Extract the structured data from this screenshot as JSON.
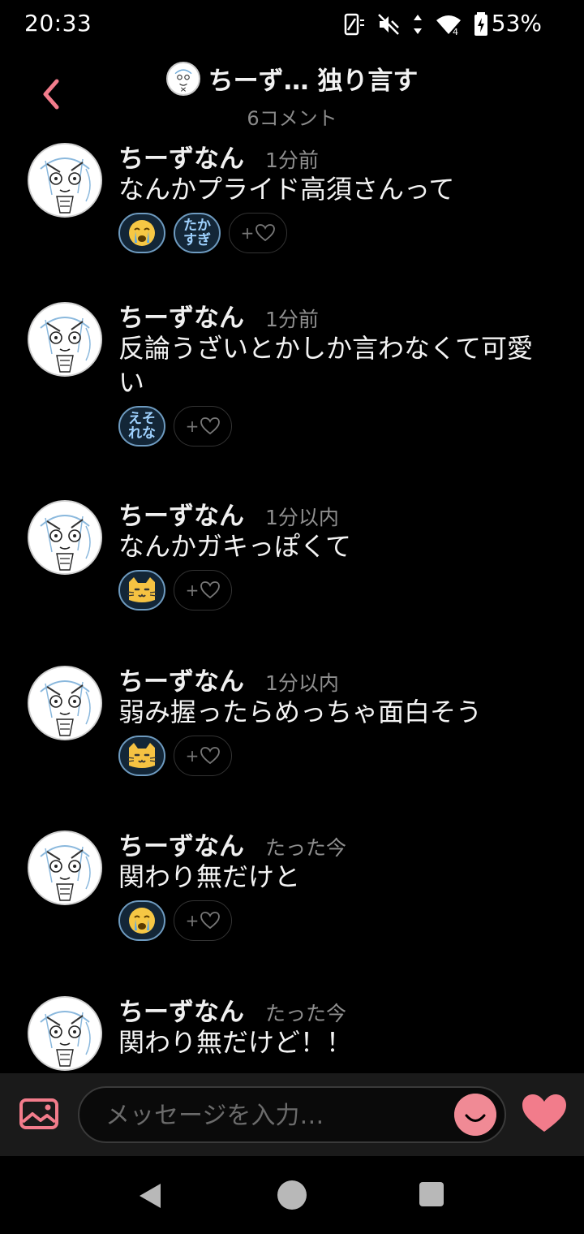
{
  "status_bar": {
    "time": "20:33",
    "battery": "53%",
    "icons": [
      "screen-rotate-icon",
      "vibrate-off-icon",
      "data-arrows-icon",
      "wifi-icon",
      "battery-charging-icon"
    ]
  },
  "header": {
    "back_icon": "chevron-left-icon",
    "title": "ちーず… 独り言す",
    "subtitle": "6コメント",
    "accent": "#f27c8b"
  },
  "comments": [
    {
      "name": "ちーずなん",
      "time": "1分前",
      "text": "なんかプライド高須さんって",
      "reactions": [
        {
          "type": "emoji",
          "icon": "crying-face-icon"
        },
        {
          "type": "stamp",
          "text": "たか\nすぎ"
        }
      ]
    },
    {
      "name": "ちーずなん",
      "time": "1分前",
      "text": "反論うざいとかしか言わなくて可愛い",
      "reactions": [
        {
          "type": "stamp",
          "text": "えそ\nれな"
        }
      ]
    },
    {
      "name": "ちーずなん",
      "time": "1分以内",
      "text": "なんかガキっぽくて",
      "reactions": [
        {
          "type": "emoji",
          "icon": "cat-face-icon"
        }
      ]
    },
    {
      "name": "ちーずなん",
      "time": "1分以内",
      "text": "弱み握ったらめっちゃ面白そう",
      "reactions": [
        {
          "type": "emoji",
          "icon": "cat-face-icon"
        }
      ]
    },
    {
      "name": "ちーずなん",
      "time": "たった今",
      "text": "関わり無だけと",
      "reactions": [
        {
          "type": "emoji",
          "icon": "crying-face-icon"
        }
      ]
    },
    {
      "name": "ちーずなん",
      "time": "たった今",
      "text": "関わり無だけど！！",
      "reactions": []
    }
  ],
  "add_reaction_label": "+",
  "composer": {
    "placeholder": "メッセージを入力…"
  },
  "colors": {
    "background": "#000000",
    "accent_pink": "#f27c8b",
    "reaction_border": "#6e9bc0"
  }
}
